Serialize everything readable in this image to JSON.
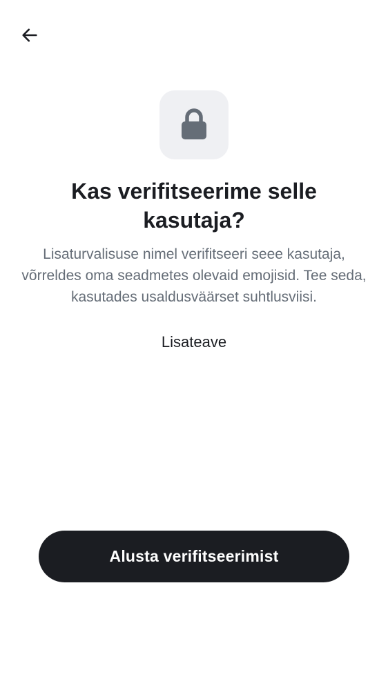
{
  "header": {
    "back_icon": "arrow-left-icon"
  },
  "hero": {
    "icon": "lock-icon",
    "icon_color": "#656d77",
    "tile_color": "#eff0f3"
  },
  "content": {
    "title": "Kas verifitseerime selle kasutaja?",
    "description": "Lisaturvalisuse nimel verifitseeri seee kasutaja, võrreldes oma seadmetes olevaid emojisid. Tee seda, kasutades usaldusväärset suhtlusviisi.",
    "learn_more_label": "Lisateave"
  },
  "actions": {
    "primary_label": "Alusta verifitseerimist",
    "primary_color": "#1b1d22"
  }
}
